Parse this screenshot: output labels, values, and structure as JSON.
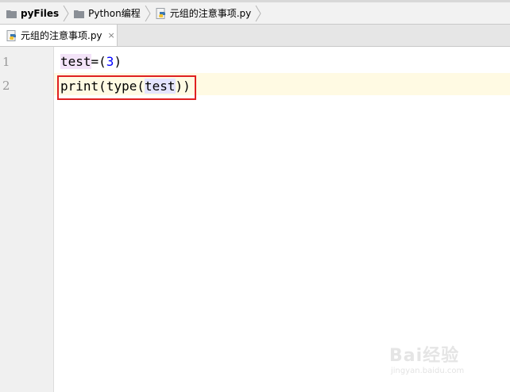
{
  "breadcrumb": {
    "items": [
      {
        "label": "pyFiles",
        "icon": "folder-icon"
      },
      {
        "label": "Python编程",
        "icon": "folder-icon"
      },
      {
        "label": "元组的注意事项.py",
        "icon": "python-file-icon"
      }
    ]
  },
  "tabs": [
    {
      "label": "元组的注意事项.py",
      "icon": "python-file-icon",
      "close": "×"
    }
  ],
  "editor": {
    "line_numbers": [
      "1",
      "2"
    ],
    "lines": [
      {
        "ident": "test",
        "op": "=(",
        "num": "3",
        "close": ")"
      },
      {
        "fn": "print",
        "p1": "(",
        "fn2": "type",
        "p2": "(",
        "ident": "test",
        "p3": "))"
      }
    ]
  },
  "watermark": {
    "brand": "Bai经验",
    "url": "jingyan.baidu.com"
  },
  "colors": {
    "caret_row": "#fffae3",
    "highlight_box": "#e02020",
    "number": "#0000ff"
  }
}
